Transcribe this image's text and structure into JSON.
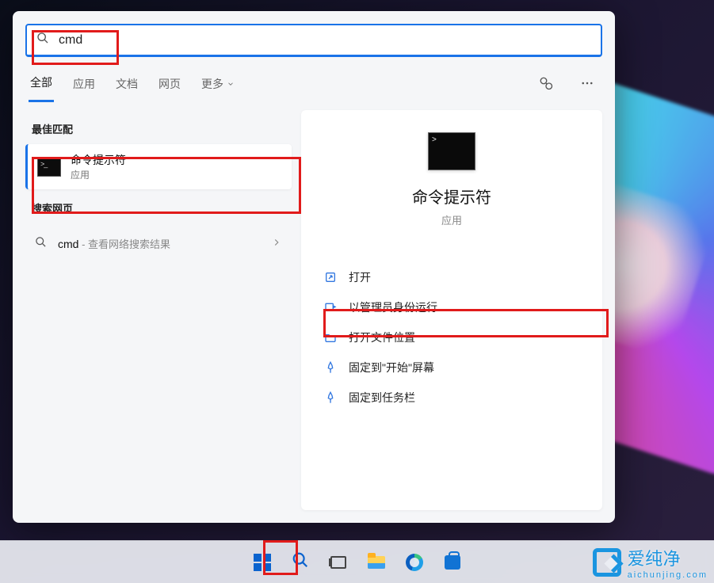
{
  "search": {
    "query": "cmd"
  },
  "tabs": {
    "items": [
      "全部",
      "应用",
      "文档",
      "网页"
    ],
    "more": "更多",
    "active_index": 0
  },
  "left": {
    "best_match_label": "最佳匹配",
    "best_match": {
      "title": "命令提示符",
      "subtitle": "应用"
    },
    "web_label": "搜索网页",
    "web_item": {
      "query": "cmd",
      "suffix": " - 查看网络搜索结果"
    }
  },
  "details": {
    "title": "命令提示符",
    "subtitle": "应用",
    "actions": [
      {
        "icon": "open",
        "label": "打开"
      },
      {
        "icon": "admin",
        "label": "以管理员身份运行"
      },
      {
        "icon": "folder",
        "label": "打开文件位置"
      },
      {
        "icon": "pin",
        "label": "固定到\"开始\"屏幕"
      },
      {
        "icon": "pin",
        "label": "固定到任务栏"
      }
    ]
  },
  "watermark": {
    "brand": "爱纯净",
    "domain": "aichunjing.com"
  },
  "annotations": {
    "highlight_boxes": [
      "search-box",
      "best-match-item",
      "run-as-admin-action",
      "taskbar-search-button"
    ]
  }
}
